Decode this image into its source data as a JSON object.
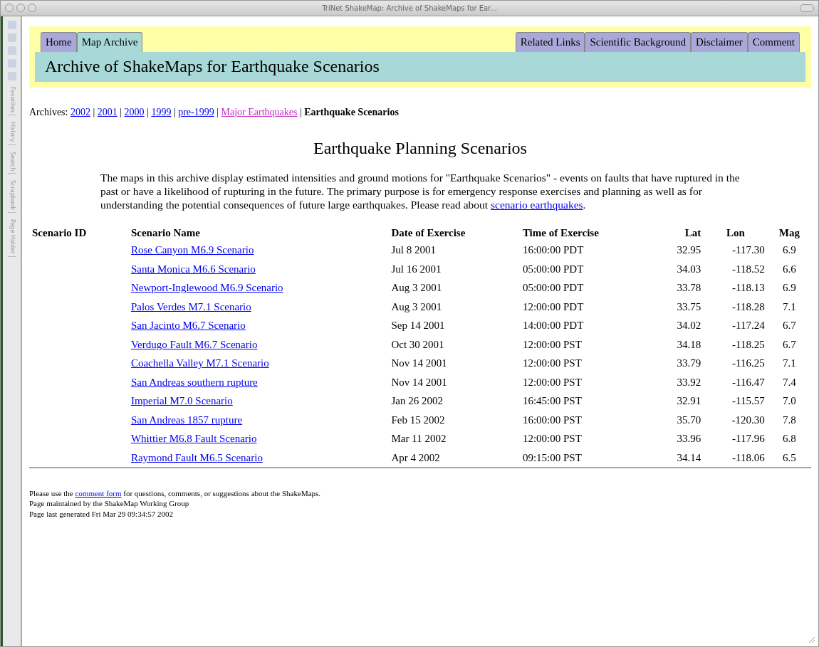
{
  "window": {
    "title": "TriNet ShakeMap: Archive of ShakeMaps for Ear..."
  },
  "side_tabs": [
    "Favorites",
    "History",
    "Search",
    "Scrapbook",
    "Page Holder"
  ],
  "tabs_left": [
    {
      "label": "Home",
      "selected": false
    },
    {
      "label": "Map Archive",
      "selected": true
    }
  ],
  "tabs_right": [
    {
      "label": "Related Links",
      "selected": false
    },
    {
      "label": "Scientific Background",
      "selected": false
    },
    {
      "label": "Disclaimer",
      "selected": false
    },
    {
      "label": "Comment",
      "selected": false
    }
  ],
  "banner": "Archive of ShakeMaps for Earthquake Scenarios",
  "archives": {
    "label": "Archives:",
    "separator": "|",
    "items": [
      {
        "text": "2002",
        "kind": "link"
      },
      {
        "text": "2001",
        "kind": "link"
      },
      {
        "text": "2000",
        "kind": "link"
      },
      {
        "text": "1999",
        "kind": "link"
      },
      {
        "text": "pre-1999",
        "kind": "link"
      },
      {
        "text": "Major Earthquakes",
        "kind": "visited"
      },
      {
        "text": "Earthquake Scenarios",
        "kind": "current"
      }
    ]
  },
  "heading": "Earthquake Planning Scenarios",
  "intro": {
    "text": "The maps in this archive display estimated intensities and ground motions for \"Earthquake Scenarios\" - events on faults that have ruptured in the past or have a likelihood of rupturing in the future. The primary purpose is for emergency response exercises and planning as well as for understanding the potential consequences of future large earthquakes. Please read about",
    "link": "scenario earthquakes",
    "after": "."
  },
  "table": {
    "columns": [
      "Scenario ID",
      "Scenario Name",
      "Date of Exercise",
      "Time of Exercise",
      "Lat",
      "Lon",
      "Mag"
    ],
    "rows": [
      [
        "",
        "Rose Canyon M6.9 Scenario",
        "Jul 8 2001",
        "16:00:00 PDT",
        "32.95",
        "-117.30",
        "6.9"
      ],
      [
        "",
        "Santa Monica M6.6 Scenario",
        "Jul 16 2001",
        "05:00:00 PDT",
        "34.03",
        "-118.52",
        "6.6"
      ],
      [
        "",
        "Newport-Inglewood M6.9 Scenario",
        "Aug 3 2001",
        "05:00:00 PDT",
        "33.78",
        "-118.13",
        "6.9"
      ],
      [
        "",
        "Palos Verdes M7.1 Scenario",
        "Aug 3 2001",
        "12:00:00 PDT",
        "33.75",
        "-118.28",
        "7.1"
      ],
      [
        "",
        "San Jacinto M6.7 Scenario",
        "Sep 14 2001",
        "14:00:00 PDT",
        "34.02",
        "-117.24",
        "6.7"
      ],
      [
        "",
        "Verdugo Fault M6.7 Scenario",
        "Oct 30 2001",
        "12:00:00 PST",
        "34.18",
        "-118.25",
        "6.7"
      ],
      [
        "",
        "Coachella Valley M7.1 Scenario",
        "Nov 14 2001",
        "12:00:00 PST",
        "33.79",
        "-116.25",
        "7.1"
      ],
      [
        "",
        "San Andreas southern rupture",
        "Nov 14 2001",
        "12:00:00 PST",
        "33.92",
        "-116.47",
        "7.4"
      ],
      [
        "",
        "Imperial M7.0 Scenario",
        "Jan 26 2002",
        "16:45:00 PST",
        "32.91",
        "-115.57",
        "7.0"
      ],
      [
        "",
        "San Andreas 1857 rupture",
        "Feb 15 2002",
        "16:00:00 PST",
        "35.70",
        "-120.30",
        "7.8"
      ],
      [
        "",
        "Whittier M6.8 Fault Scenario",
        "Mar 11 2002",
        "12:00:00 PST",
        "33.96",
        "-117.96",
        "6.8"
      ],
      [
        "",
        "Raymond Fault M6.5 Scenario",
        "Apr 4 2002",
        "09:15:00 PST",
        "34.14",
        "-118.06",
        "6.5"
      ]
    ]
  },
  "footer": {
    "before": "Please use the",
    "link": "comment form",
    "after": "for questions, comments, or suggestions about the ShakeMaps.",
    "lines": [
      "Page maintained by the ShakeMap Working Group",
      "Page last generated Fri Mar 29 09:34:57 2002"
    ]
  }
}
